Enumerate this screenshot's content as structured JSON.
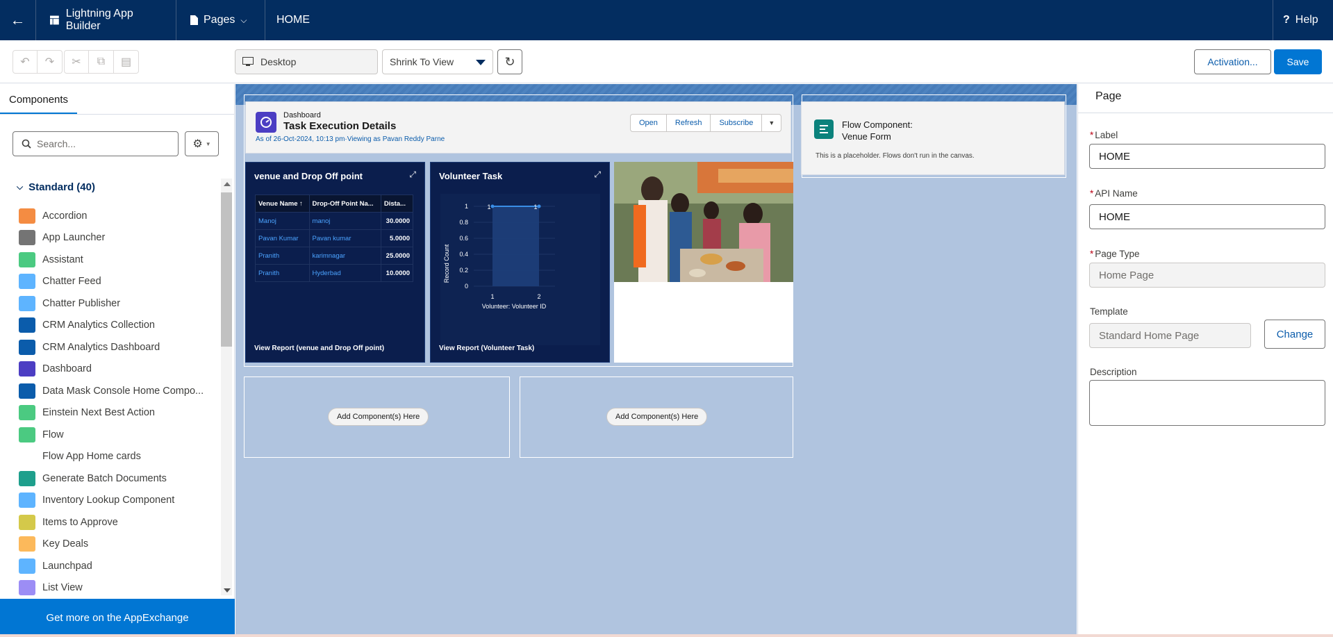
{
  "header": {
    "app_name": "Lightning App Builder",
    "pages_label": "Pages",
    "page_name": "HOME",
    "help_label": "Help"
  },
  "toolbar": {
    "device": "Desktop",
    "view_mode": "Shrink To View",
    "activation_label": "Activation...",
    "save_label": "Save"
  },
  "left_panel": {
    "tab_label": "Components",
    "search_placeholder": "Search...",
    "group_label": "Standard (40)",
    "components": [
      {
        "label": "Accordion",
        "icon": "accordion-icon",
        "color": "#f48c42"
      },
      {
        "label": "App Launcher",
        "icon": "app-launcher-icon",
        "color": "#747474"
      },
      {
        "label": "Assistant",
        "icon": "assistant-icon",
        "color": "#4bca81"
      },
      {
        "label": "Chatter Feed",
        "icon": "chatter-feed-icon",
        "color": "#5eb4ff"
      },
      {
        "label": "Chatter Publisher",
        "icon": "chatter-publisher-icon",
        "color": "#5eb4ff"
      },
      {
        "label": "CRM Analytics Collection",
        "icon": "analytics-collection-icon",
        "color": "#0b5cab"
      },
      {
        "label": "CRM Analytics Dashboard",
        "icon": "analytics-dashboard-icon",
        "color": "#0b5cab"
      },
      {
        "label": "Dashboard",
        "icon": "dashboard-icon",
        "color": "#4c3ec3"
      },
      {
        "label": "Data Mask Console Home Compo...",
        "icon": "data-mask-icon",
        "color": "#0b5cab"
      },
      {
        "label": "Einstein Next Best Action",
        "icon": "einstein-icon",
        "color": "#4bca81"
      },
      {
        "label": "Flow",
        "icon": "flow-icon",
        "color": "#4bca81"
      },
      {
        "label": "Flow App Home cards",
        "icon": "",
        "color": ""
      },
      {
        "label": "Generate Batch Documents",
        "icon": "batch-documents-icon",
        "color": "#1e9f8c"
      },
      {
        "label": "Inventory Lookup Component",
        "icon": "inventory-icon",
        "color": "#5eb4ff"
      },
      {
        "label": "Items to Approve",
        "icon": "approve-icon",
        "color": "#d4c94a"
      },
      {
        "label": "Key Deals",
        "icon": "key-deals-icon",
        "color": "#fcb95b"
      },
      {
        "label": "Launchpad",
        "icon": "launchpad-icon",
        "color": "#5eb4ff"
      },
      {
        "label": "List View",
        "icon": "list-view-icon",
        "color": "#9c8df5"
      }
    ],
    "appexchange_label": "Get more on the AppExchange"
  },
  "canvas": {
    "dashboard": {
      "type_label": "Dashboard",
      "title": "Task Execution Details",
      "subtitle": "As of 26-Oct-2024, 10:13 pm·Viewing as Pavan Reddy Parne",
      "buttons": [
        "Open",
        "Refresh",
        "Subscribe"
      ]
    },
    "table_widget": {
      "title": "venue and Drop Off point",
      "columns": [
        "Venue Name ↑",
        "Drop-Off Point Na...",
        "Dista..."
      ],
      "rows": [
        [
          "Manoj",
          "manoj",
          "30.0000"
        ],
        [
          "Pavan Kumar",
          "Pavan kumar",
          "5.0000"
        ],
        [
          "Pranith",
          "karimnagar",
          "25.0000"
        ],
        [
          "Pranith",
          "Hyderbad",
          "10.0000"
        ]
      ],
      "footer": "View Report (venue and Drop Off point)"
    },
    "chart_widget": {
      "title": "Volunteer Task",
      "footer": "View Report (Volunteer Task)"
    },
    "flow_card": {
      "title_line1": "Flow Component:",
      "title_line2": "Venue Form",
      "note": "This is a placeholder. Flows don't run in the canvas."
    },
    "add_component_label": "Add Component(s) Here"
  },
  "chart_data": {
    "type": "line",
    "title": "Volunteer Task",
    "xlabel": "Volunteer: Volunteer ID",
    "ylabel": "Record Count",
    "categories": [
      "1",
      "2"
    ],
    "values": [
      1,
      1
    ],
    "data_labels": [
      "1",
      "1"
    ],
    "yticks": [
      "1",
      "0.8",
      "0.6",
      "0.4",
      "0.2",
      "0"
    ],
    "ylim": [
      0,
      1
    ]
  },
  "right_panel": {
    "title": "Page",
    "label_label": "Label",
    "label_value": "HOME",
    "api_label": "API Name",
    "api_value": "HOME",
    "page_type_label": "Page Type",
    "page_type_value": "Home Page",
    "template_label": "Template",
    "template_value": "Standard Home Page",
    "change_label": "Change",
    "description_label": "Description",
    "required_mark": "*"
  }
}
